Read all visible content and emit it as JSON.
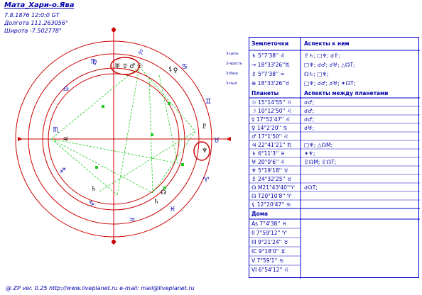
{
  "header": {
    "name": "Мата_Хари-о.Ява",
    "datetime": "7.8.1876 12:0:0 GT",
    "longitude": "Долгота 111.263056°",
    "latitude": "Широта -7.502778°"
  },
  "wheel": {
    "signs": [
      "♈",
      "♉",
      "♊",
      "♋",
      "♌",
      "♍",
      "♎",
      "♏",
      "♐",
      "♑",
      "♒",
      "♓"
    ],
    "legend": [
      "3-цель",
      "3-ярость",
      "3-база",
      "3-пыл"
    ],
    "aspect_line_color": "#22cc22",
    "ring_color": "#cc0000"
  },
  "table": {
    "header1": {
      "col1": "Землеточки",
      "col2": "Аспекты к ним"
    },
    "earth_points": [
      {
        "name": "♄ 5°7'38'' ♌",
        "aspects": "♇♄; □♆; ☌♇;"
      },
      {
        "name": "→ 18°33'26''♏",
        "aspects": "□♆; ☌♂; ☌♅; △☊Т;"
      },
      {
        "name": "♇ 5°7'38'' ≈",
        "aspects": "☊♄; □♆;"
      },
      {
        "name": "⊕ 18°33'26''♉",
        "aspects": "□♆; ☌♂; ☌♅; ✶☊Т;"
      }
    ],
    "header2": {
      "col1": "Планеты",
      "col2": "Аспекты между планетами"
    },
    "planets": [
      {
        "name": "☉ 15°14'55'' ♌",
        "aspects": "☌♂;"
      },
      {
        "name": "☽ 10°12'50'' ♌",
        "aspects": "☌♂;"
      },
      {
        "name": "☿ 17°52'47'' ♌",
        "aspects": "☌♂;"
      },
      {
        "name": "♀ 14°2'20'' ♋",
        "aspects": "☌♅;"
      },
      {
        "name": "♂ 17°1'50'' ♌",
        "aspects": ""
      },
      {
        "name": "♃ 22°41'21'' ♏",
        "aspects": "□♅; △☊М;"
      },
      {
        "name": "♄ 6°11'3'' ♓",
        "aspects": "✶♆;"
      },
      {
        "name": "♅ 20°0'6'' ♌",
        "aspects": "♇☊М; ♇☊Т;"
      },
      {
        "name": "♆ 5°19'18'' ♉",
        "aspects": ""
      },
      {
        "name": "♇ 24°32'25'' ♉",
        "aspects": ""
      },
      {
        "name": "☊ М21°43'40''♈",
        "aspects": "☌☊Т;"
      },
      {
        "name": "☊ Т20°10'8'' ♈",
        "aspects": ""
      },
      {
        "name": "⚸ 12°20'47'' ♋",
        "aspects": ""
      }
    ],
    "header3": {
      "col1": "Дома"
    },
    "houses": [
      {
        "name": "As 7°4'38'' ♓"
      },
      {
        "name": "II 7°59'12'' ♈"
      },
      {
        "name": "III 9°21'24'' ♉"
      },
      {
        "name": "IC 9°18'0'' ♊"
      },
      {
        "name": "V 7°59'1'' ♋"
      },
      {
        "name": "VI 6°54'12'' ♌"
      }
    ]
  },
  "footer": "@ ZP  ver. 0.25 http://www.liveplanet.ru  e-mail: mail@liveplanet.ru",
  "chart_data": {
    "type": "astrological-wheel",
    "ascendant": "7°4'38'' ♓",
    "planets": [
      {
        "body": "☉",
        "sign": "♌",
        "deg": 15.25
      },
      {
        "body": "☽",
        "sign": "♌",
        "deg": 10.21
      },
      {
        "body": "☿",
        "sign": "♌",
        "deg": 17.88
      },
      {
        "body": "♀",
        "sign": "♋",
        "deg": 14.04
      },
      {
        "body": "♂",
        "sign": "♌",
        "deg": 17.03
      },
      {
        "body": "♃",
        "sign": "♏",
        "deg": 22.69
      },
      {
        "body": "♄",
        "sign": "♓",
        "deg": 6.18
      },
      {
        "body": "♅",
        "sign": "♌",
        "deg": 20.0
      },
      {
        "body": "♆",
        "sign": "♉",
        "deg": 5.32
      },
      {
        "body": "♇",
        "sign": "♉",
        "deg": 24.54
      }
    ]
  }
}
